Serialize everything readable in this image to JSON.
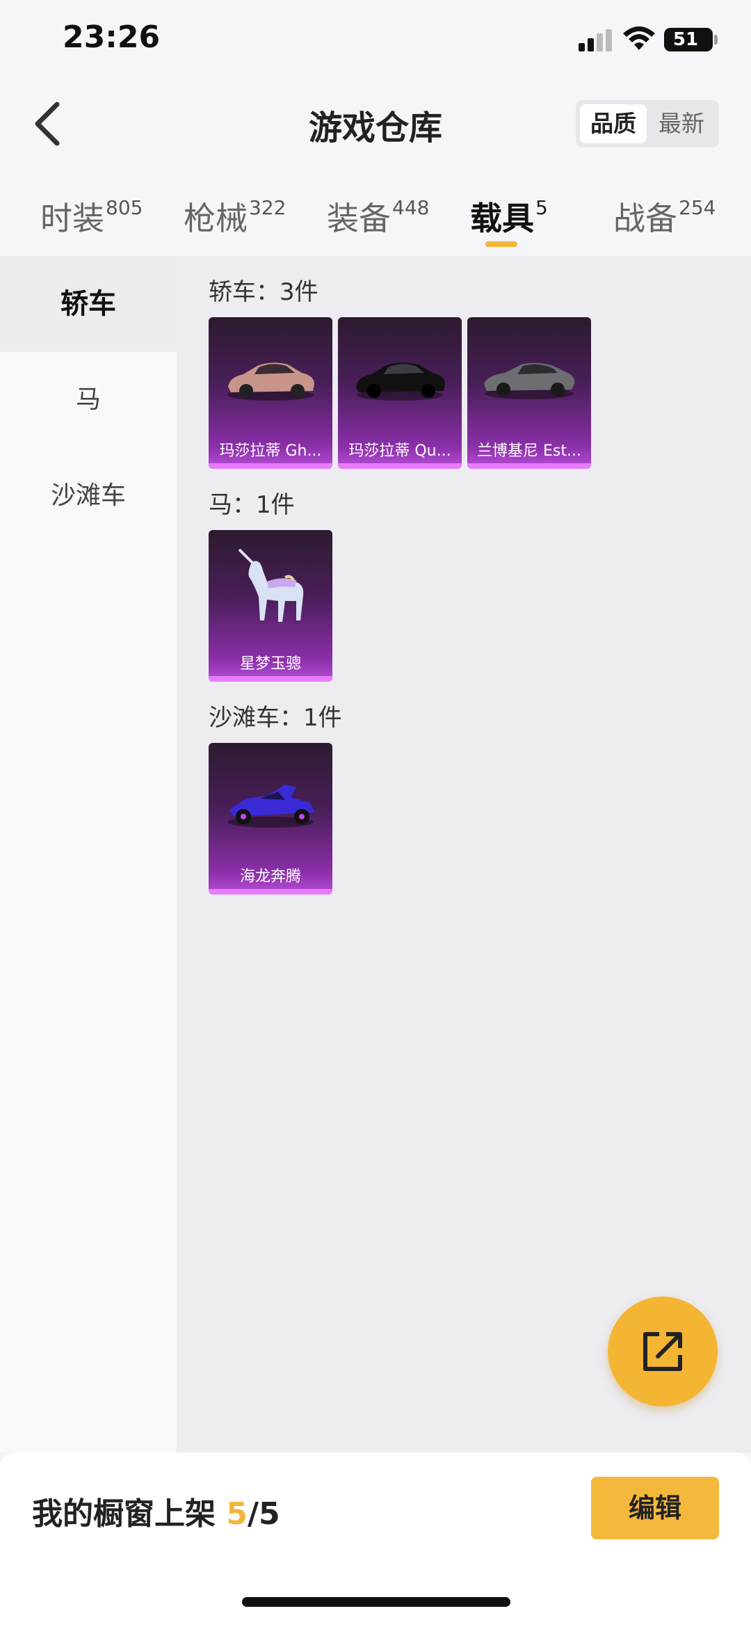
{
  "status_bar": {
    "time": "23:26",
    "battery": "51"
  },
  "header": {
    "title": "游戏仓库",
    "sort_options": [
      "品质",
      "最新"
    ],
    "selected_sort": "品质"
  },
  "tabs": [
    {
      "label": "时装",
      "count": "805"
    },
    {
      "label": "枪械",
      "count": "322"
    },
    {
      "label": "装备",
      "count": "448"
    },
    {
      "label": "载具",
      "count": "5"
    },
    {
      "label": "战备",
      "count": "254"
    }
  ],
  "active_tab": "载具",
  "sidebar": {
    "items": [
      "轿车",
      "马",
      "沙滩车"
    ],
    "active": "轿车"
  },
  "groups": [
    {
      "title": "轿车：3件",
      "items": [
        "玛莎拉蒂 Gh...",
        "玛莎拉蒂 Qu...",
        "兰博基尼 Est..."
      ]
    },
    {
      "title": "马：1件",
      "items": [
        "星梦玉骢"
      ]
    },
    {
      "title": "沙滩车：1件",
      "items": [
        "海龙奔腾"
      ]
    }
  ],
  "footer": {
    "label": "我的橱窗上架",
    "current": "5",
    "separator": "/",
    "total": "5",
    "edit_label": "编辑"
  },
  "colors": {
    "accent": "#f4b93c",
    "card_bottom": "#b84fd8",
    "card_top": "#2c1a2f"
  },
  "icons": [
    "cellular-signal-icon",
    "wifi-icon",
    "battery-icon",
    "back-chevron-icon",
    "share-export-icon"
  ]
}
